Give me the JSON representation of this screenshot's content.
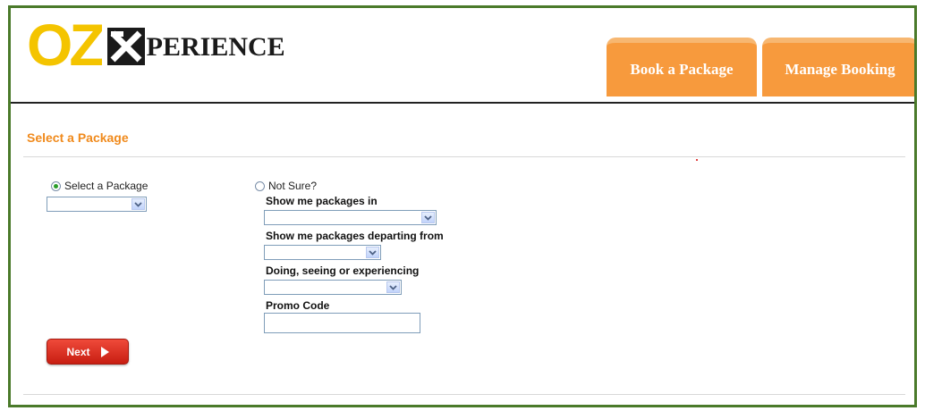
{
  "logo": {
    "part1": "OZ",
    "part2": "PERIENCE"
  },
  "nav": {
    "book_label": "Book a Package",
    "manage_label": "Manage Booking"
  },
  "page": {
    "title": "Select a Package"
  },
  "form": {
    "option_select_label": "Select a Package",
    "option_not_sure_label": "Not Sure?",
    "selected_option": "Select a Package",
    "package_select_value": "",
    "packages_in_label": "Show me packages in",
    "packages_in_value": "",
    "departing_from_label": "Show me packages departing from",
    "departing_from_value": "",
    "doing_label": "Doing, seeing or experiencing",
    "doing_value": "",
    "promo_label": "Promo Code",
    "promo_value": "",
    "next_label": "Next"
  },
  "colors": {
    "frame_border": "#4a7a2a",
    "nav_button": "#f79a3d",
    "section_title": "#f08a1c",
    "logo_yellow": "#f4c400",
    "next_button": "#d82a1c"
  }
}
